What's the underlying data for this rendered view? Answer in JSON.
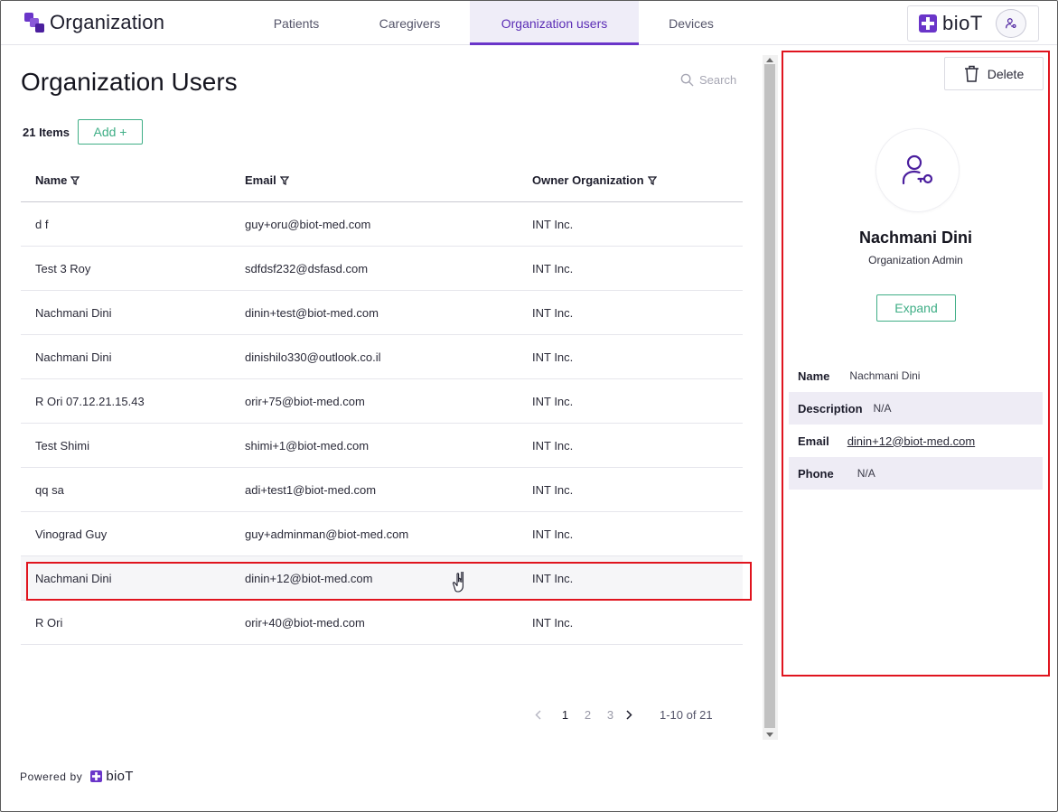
{
  "app": {
    "title": "Organization",
    "brand": "bioT",
    "colors": {
      "accent": "#6a35c9",
      "green": "#3fae86",
      "highlight": "#e0141e"
    }
  },
  "nav": {
    "tabs": [
      {
        "label": "Patients",
        "active": false
      },
      {
        "label": "Caregivers",
        "active": false
      },
      {
        "label": "Organization users",
        "active": true
      },
      {
        "label": "Devices",
        "active": false
      }
    ]
  },
  "main": {
    "title": "Organization Users",
    "search_placeholder": "Search",
    "count_label": "21 Items",
    "add_label": "Add +",
    "columns": [
      "Name",
      "Email",
      "Owner Organization"
    ],
    "rows": [
      {
        "name": "d f",
        "email": "guy+oru@biot-med.com",
        "org": "INT Inc."
      },
      {
        "name": "Test 3 Roy",
        "email": "sdfdsf232@dsfasd.com",
        "org": "INT Inc."
      },
      {
        "name": "Nachmani Dini",
        "email": "dinin+test@biot-med.com",
        "org": "INT Inc."
      },
      {
        "name": "Nachmani Dini",
        "email": "dinishilo330@outlook.co.il",
        "org": "INT Inc."
      },
      {
        "name": "R Ori 07.12.21.15.43",
        "email": "orir+75@biot-med.com",
        "org": "INT Inc."
      },
      {
        "name": "Test Shimi",
        "email": "shimi+1@biot-med.com",
        "org": "INT Inc."
      },
      {
        "name": "qq sa",
        "email": "adi+test1@biot-med.com",
        "org": "INT Inc."
      },
      {
        "name": "Vinograd Guy",
        "email": "guy+adminman@biot-med.com",
        "org": "INT Inc."
      },
      {
        "name": "Nachmani Dini",
        "email": "dinin+12@biot-med.com",
        "org": "INT Inc."
      },
      {
        "name": "R Ori",
        "email": "orir+40@biot-med.com",
        "org": "INT Inc."
      }
    ],
    "pagination": {
      "pages": [
        "1",
        "2",
        "3"
      ],
      "current": "1",
      "range": "1-10 of 21"
    }
  },
  "footer": {
    "powered_by": "Powered by",
    "brand": "bioT"
  },
  "panel": {
    "delete_label": "Delete",
    "name": "Nachmani Dini",
    "role": "Organization Admin",
    "expand_label": "Expand",
    "fields": [
      {
        "label": "Name",
        "value": "Nachmani Dini"
      },
      {
        "label": "Description",
        "value": "N/A"
      },
      {
        "label": "Email",
        "value": "dinin+12@biot-med.com"
      },
      {
        "label": "Phone",
        "value": "N/A"
      }
    ]
  }
}
